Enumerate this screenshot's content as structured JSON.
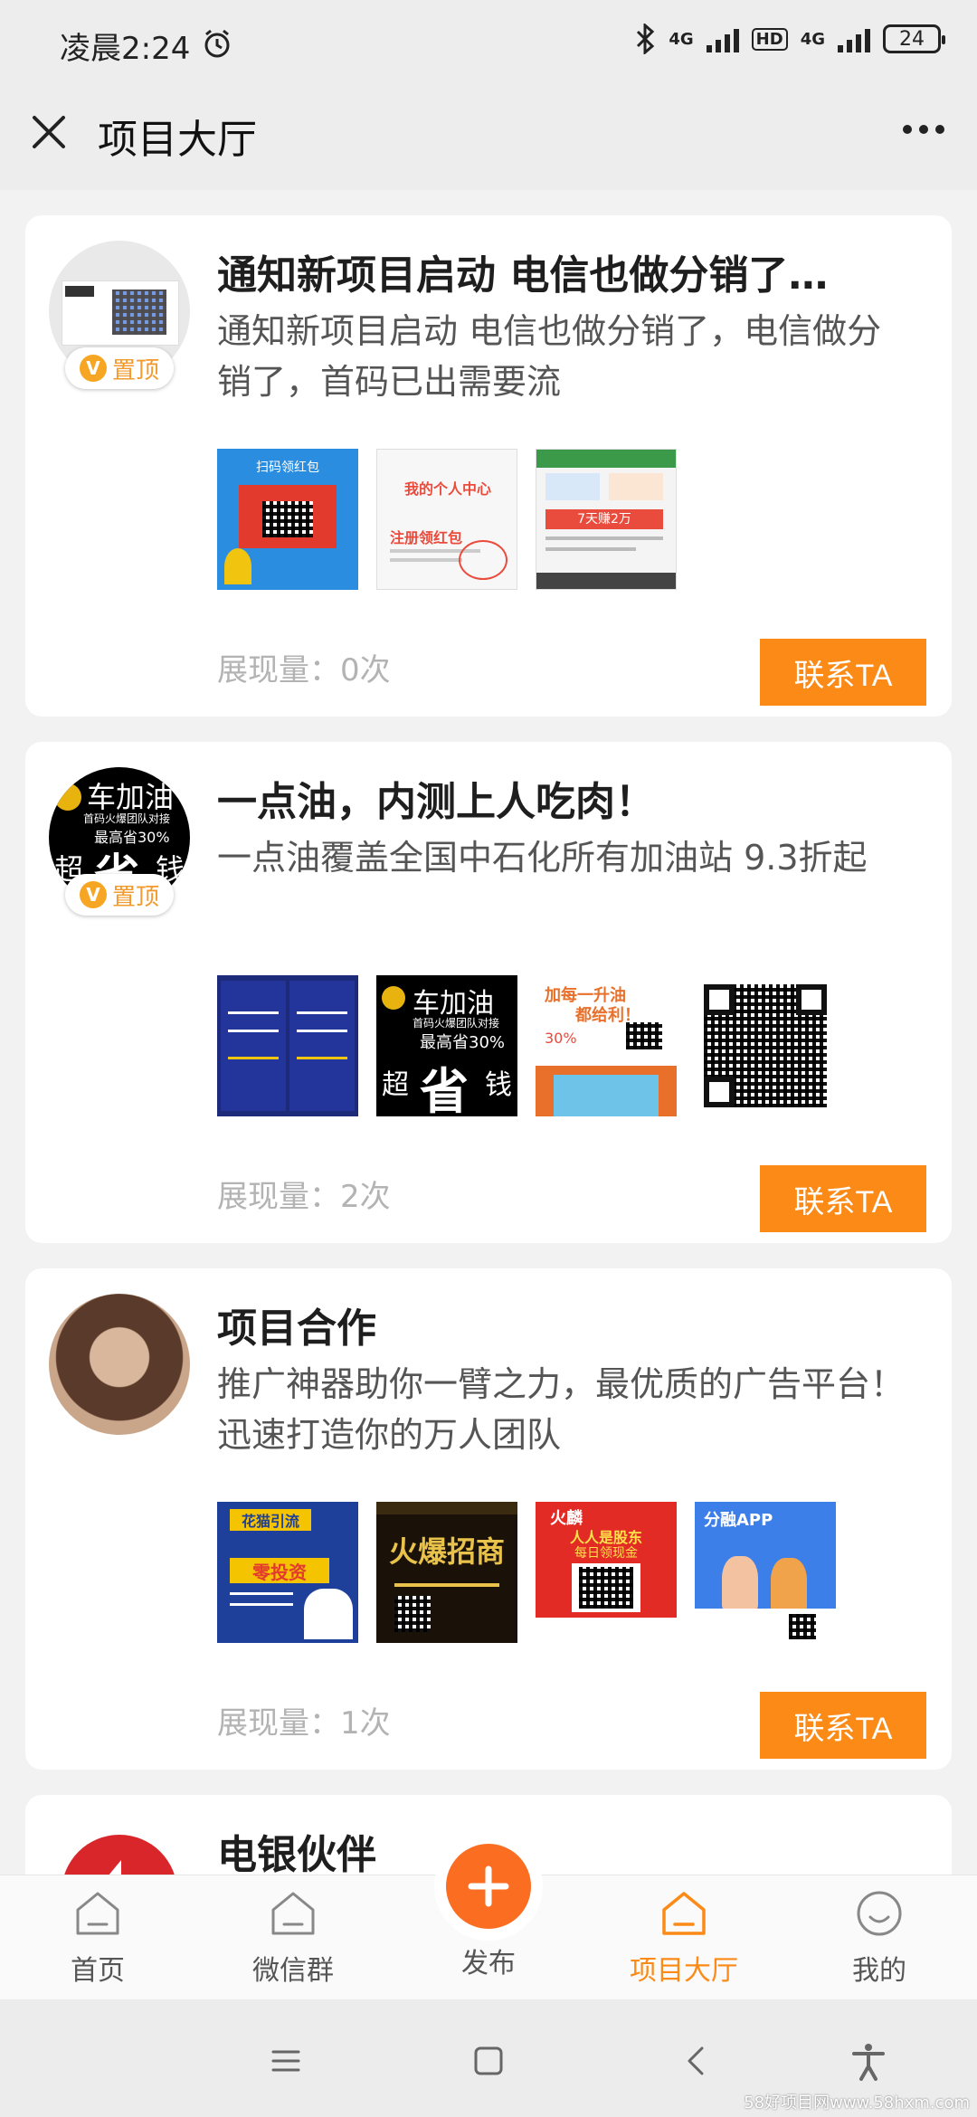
{
  "status_bar": {
    "time": "凌晨2:24",
    "network1": "4G",
    "hd": "HD",
    "network2": "4G",
    "battery": "24"
  },
  "header": {
    "title": "项目大厅"
  },
  "cards": [
    {
      "title": "通知新项目启动 电信也做分销了…",
      "description": "通知新项目启动 电信也做分销了，电信做分销了，首码已出需要流",
      "badge": "置顶",
      "badge_v": "V",
      "views": "展现量：0次",
      "button": "联系TA",
      "thumb_texts": [
        "扫码领红包",
        "我的个人中心",
        "注册领红包",
        "7天赚2万"
      ]
    },
    {
      "title": "一点油，内测上人吃肉！",
      "description": "一点油覆盖全国中石化所有加油站 9.3折起",
      "badge": "置顶",
      "badge_v": "V",
      "views": "展现量：2次",
      "button": "联系TA",
      "avatar_text": [
        "车加油",
        "首码火爆团队对接",
        "最高省30%",
        "超",
        "省",
        "钱"
      ],
      "thumb_texts": [
        "车加油",
        "首码火爆团队对接",
        "最高省30%",
        "超",
        "省",
        "钱",
        "加每一升油",
        "都给利！",
        "30%"
      ]
    },
    {
      "title": "项目合作",
      "description": "推广神器助你一臂之力，最优质的广告平台！迅速打造你的万人团队",
      "views": "展现量：1次",
      "button": "联系TA",
      "thumb_texts": [
        "花猫引流",
        "零投资",
        "火爆招商",
        "火麟",
        "人人是股东",
        "每日领现金",
        "分融APP"
      ]
    },
    {
      "title": "电银伙伴"
    }
  ],
  "bottom_nav": {
    "items": [
      {
        "label": "首页"
      },
      {
        "label": "微信群"
      },
      {
        "label": "发布"
      },
      {
        "label": "项目大厅"
      },
      {
        "label": "我的"
      }
    ]
  },
  "watermark": "58好项目网www.58hxm.com",
  "colors": {
    "accent": "#fb8a16",
    "publish": "#fb6d21",
    "badge": "#f6a623"
  }
}
